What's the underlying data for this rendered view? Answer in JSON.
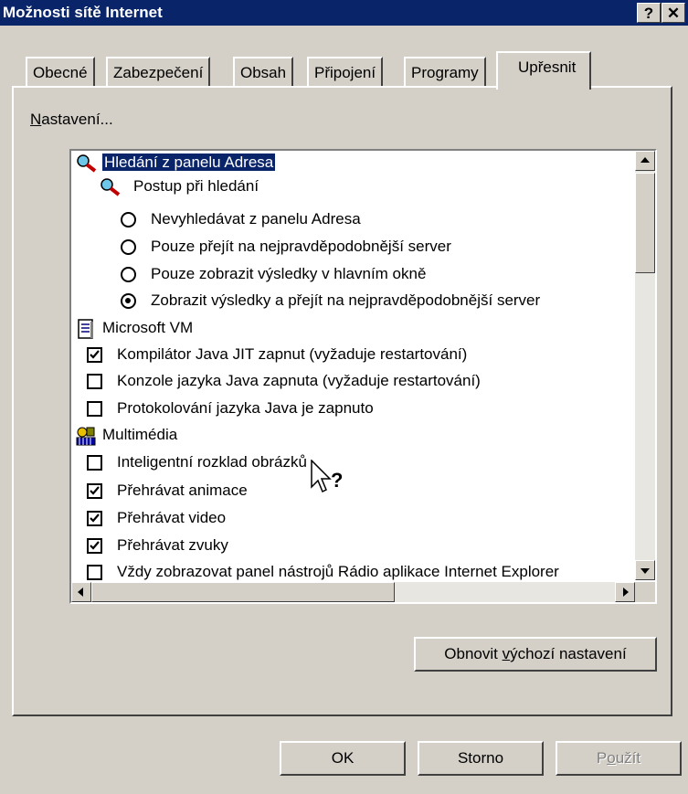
{
  "window": {
    "title": "Možnosti sítě Internet",
    "help_label": "?",
    "close_label": "✕"
  },
  "tabs": [
    {
      "label": "Obecné"
    },
    {
      "label": "Zabezpečení"
    },
    {
      "label": "Obsah"
    },
    {
      "label": "Připojení"
    },
    {
      "label": "Programy"
    },
    {
      "label": "Upřesnit",
      "active": true
    }
  ],
  "settings": {
    "group_label_u": "N",
    "group_label_rest": "astavení...",
    "items": [
      {
        "kind": "category",
        "icon": "search-icon",
        "label": "Hledání z panelu Adresa",
        "selected": true
      },
      {
        "kind": "subcategory",
        "icon": "search-icon",
        "label": "Postup při hledání"
      },
      {
        "kind": "radio",
        "checked": false,
        "label": "Nevyhledávat z panelu Adresa"
      },
      {
        "kind": "radio",
        "checked": false,
        "label": "Pouze přejít na nejpravděpodobnější server"
      },
      {
        "kind": "radio",
        "checked": false,
        "label": "Pouze zobrazit výsledky v hlavním okně"
      },
      {
        "kind": "radio",
        "checked": true,
        "label": "Zobrazit výsledky a přejít na nejpravděpodobnější server"
      },
      {
        "kind": "category",
        "icon": "document-icon",
        "label": "Microsoft VM"
      },
      {
        "kind": "checkbox",
        "checked": true,
        "label": "Kompilátor Java JIT zapnut (vyžaduje restartování)"
      },
      {
        "kind": "checkbox",
        "checked": false,
        "label": "Konzole jazyka Java zapnuta (vyžaduje restartování)"
      },
      {
        "kind": "checkbox",
        "checked": false,
        "label": "Protokolování jazyka Java je zapnuto"
      },
      {
        "kind": "category",
        "icon": "multimedia-icon",
        "label": "Multimédia"
      },
      {
        "kind": "checkbox",
        "checked": false,
        "label": "Inteligentní rozklad obrázků"
      },
      {
        "kind": "checkbox",
        "checked": true,
        "label": "Přehrávat animace"
      },
      {
        "kind": "checkbox",
        "checked": true,
        "label": "Přehrávat video"
      },
      {
        "kind": "checkbox",
        "checked": true,
        "label": "Přehrávat zvuky"
      },
      {
        "kind": "checkbox",
        "checked": false,
        "label": "Vždy zobrazovat panel nástrojů Rádio aplikace Internet Explorer"
      }
    ]
  },
  "restore": {
    "pre": "Obnovit ",
    "u": "v",
    "post": "ýchozí nastavení"
  },
  "buttons": {
    "ok": "OK",
    "cancel": "Storno",
    "apply_pre": "P",
    "apply_u": "o",
    "apply_post": "užít"
  },
  "cursor": {
    "icon": "help-cursor-icon"
  }
}
